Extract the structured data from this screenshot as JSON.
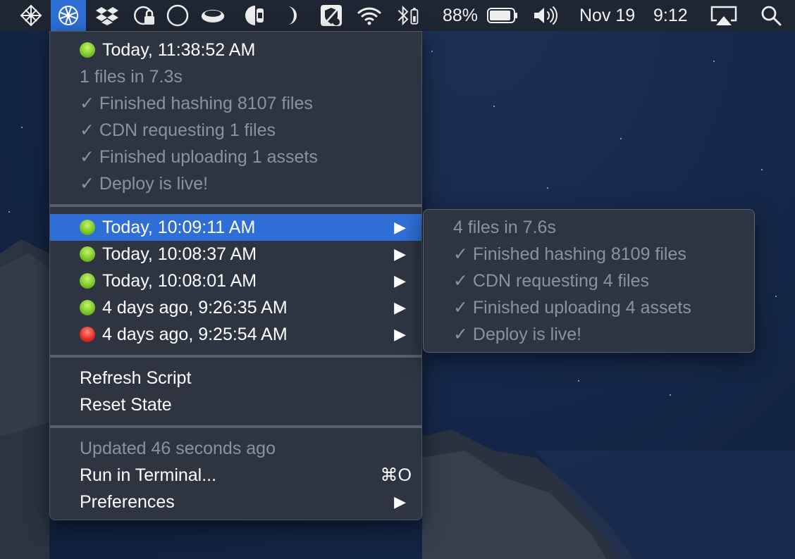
{
  "menubar": {
    "battery": "88%",
    "date": "Nov 19",
    "time": "9:12"
  },
  "menu": {
    "latest": {
      "title": "Today, 11:38:52 AM",
      "status": "green",
      "details": [
        "1 files in 7.3s",
        "✓ Finished hashing 8107 files",
        "✓ CDN requesting 1 files",
        "✓ Finished uploading 1 assets",
        "✓ Deploy is live!"
      ]
    },
    "deploys": [
      {
        "label": "Today, 10:09:11 AM",
        "status": "green"
      },
      {
        "label": "Today, 10:08:37 AM",
        "status": "green"
      },
      {
        "label": "Today, 10:08:01 AM",
        "status": "green"
      },
      {
        "label": "4 days ago, 9:26:35 AM",
        "status": "green"
      },
      {
        "label": "4 days ago, 9:25:54 AM",
        "status": "red"
      }
    ],
    "actions": {
      "refresh": "Refresh Script",
      "reset": "Reset State"
    },
    "footer": {
      "updated": "Updated 46 seconds ago",
      "run_terminal": "Run in Terminal...",
      "run_shortcut": "⌘O",
      "preferences": "Preferences"
    }
  },
  "submenu": {
    "items": [
      "4 files in 7.6s",
      "✓ Finished hashing 8109 files",
      "✓ CDN requesting 4 files",
      "✓ Finished uploading 4 assets",
      "✓ Deploy is live!"
    ]
  },
  "colors": {
    "highlight": "#2f6fd5",
    "status_green": "#7ccb2a",
    "status_red": "#e0302a",
    "menubar_active": "#2e6fd6"
  }
}
